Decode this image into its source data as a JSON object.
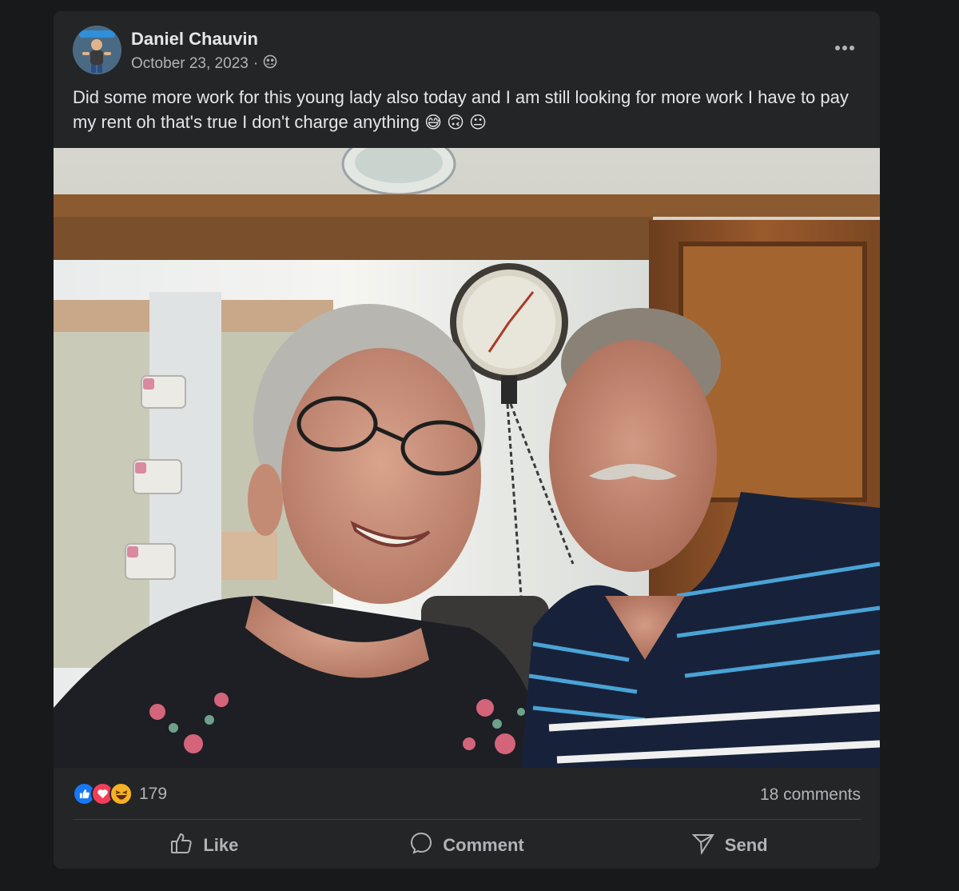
{
  "post": {
    "author": "Daniel Chauvin",
    "date": "October 23, 2023",
    "separator": "·",
    "audience_icon": "friends-icon",
    "caption_text": "Did some more work for this young lady also today and I am still looking for more work I have to pay my rent oh that's true I  don't charge anything",
    "caption_emojis": [
      "😅",
      "🙃",
      "😐"
    ],
    "reaction_count": "179",
    "comments_count": "18 comments",
    "actions": {
      "like": "Like",
      "comment": "Comment",
      "send": "Send"
    }
  },
  "colors": {
    "page_bg": "#18191a",
    "card_bg": "#242526",
    "text_primary": "#e4e6eb",
    "text_secondary": "#b0b3b8",
    "like_blue": "#1877f2",
    "love_red": "#f33e58",
    "haha_yellow": "#f7b125"
  }
}
